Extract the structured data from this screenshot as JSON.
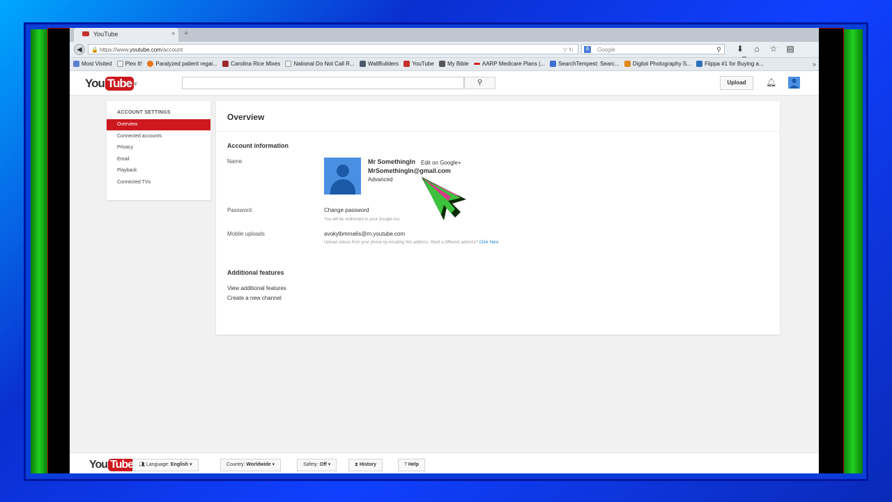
{
  "browser": {
    "tab_title": "YouTube",
    "tab_close": "×",
    "new_tab": "+",
    "url_prefix": "https://www.",
    "url_domain": "youtube.com",
    "url_path": "/account",
    "search_placeholder": "Google"
  },
  "bookmarks": [
    {
      "label": "Most Visited",
      "color": "#5b7fd0"
    },
    {
      "label": "Plex It!",
      "color": "#eeeeee"
    },
    {
      "label": "Paralyzed patient regai...",
      "color": "#e8761c"
    },
    {
      "label": "Carolina Rice Mixes",
      "color": "#9b2b2b"
    },
    {
      "label": "National Do Not Call R...",
      "color": "#eeeeee"
    },
    {
      "label": "WallBuilders",
      "color": "#4a5a6a"
    },
    {
      "label": "YouTube",
      "color": "#c4302b"
    },
    {
      "label": "My Bible",
      "color": "#555555"
    },
    {
      "label": "AARP Medicare Plans |...",
      "color": "#d02020"
    },
    {
      "label": "SearchTempest: Searc...",
      "color": "#3b6fd0"
    },
    {
      "label": "Digital Photography S...",
      "color": "#e08a1c"
    },
    {
      "label": "Flippa #1 for Buying a...",
      "color": "#2a6fb8"
    }
  ],
  "masthead": {
    "logo_you": "You",
    "logo_tube": "Tube",
    "upload": "Upload"
  },
  "sidebar": {
    "title": "ACCOUNT SETTINGS",
    "items": [
      "Overview",
      "Connected accounts",
      "Privacy",
      "Email",
      "Playback",
      "Connected TVs"
    ]
  },
  "main": {
    "title": "Overview",
    "account_info_heading": "Account information",
    "name_label": "Name",
    "display_name": "Mr SomethingIn",
    "edit_link": "Edit on Google+",
    "email": "MrSomethingIn@gmail.com",
    "advanced_link": "Advanced",
    "password_label": "Password",
    "change_password": "Change password",
    "password_hint": "You will be redirected to your Google Acc",
    "mobile_label": "Mobile uploads",
    "mobile_address": "avokylbmma6s@m.youtube.com",
    "mobile_hint": "Upload videos from your phone by emailing this address. Want a different address?",
    "mobile_hint_link": "Click Here",
    "additional_heading": "Additional features",
    "view_additional": "View additional features",
    "create_channel": "Create a new channel"
  },
  "footer": {
    "language_label": "Language:",
    "language_value": "English",
    "country_label": "Country:",
    "country_value": "Worldwide",
    "safety_label": "Safety:",
    "safety_value": "Off",
    "history": "History",
    "help": "Help"
  }
}
